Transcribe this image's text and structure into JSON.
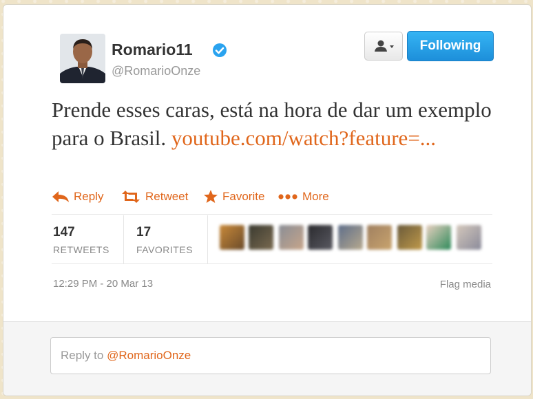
{
  "profile": {
    "name": "Romario11",
    "handle": "@RomarioOnze",
    "verified": true,
    "avatar_icon": "profile-photo"
  },
  "header_actions": {
    "follow_menu_icon": "user-dropdown-icon",
    "following_label": "Following"
  },
  "tweet": {
    "text": "Prende esses caras, está na hora de dar um exemplo para o Brasil. ",
    "link": "youtube.com/watch?feature=..."
  },
  "actions": [
    {
      "label": "Reply",
      "icon": "reply-arrow-icon"
    },
    {
      "label": "Retweet",
      "icon": "retweet-icon"
    },
    {
      "label": "Favorite",
      "icon": "star-icon"
    },
    {
      "label": "More",
      "icon": "more-dots-icon"
    }
  ],
  "stats": {
    "retweets_count": "147",
    "retweets_label": "RETWEETS",
    "favorites_count": "17",
    "favorites_label": "FAVORITES"
  },
  "timestamp": "12:29 PM - 20 Mar 13",
  "flag_media_label": "Flag media",
  "reply": {
    "prefix": "Reply to ",
    "mention": "@RomarioOnze"
  },
  "colors": {
    "link": "#e0661b",
    "button_blue": "#2aa3ef"
  }
}
